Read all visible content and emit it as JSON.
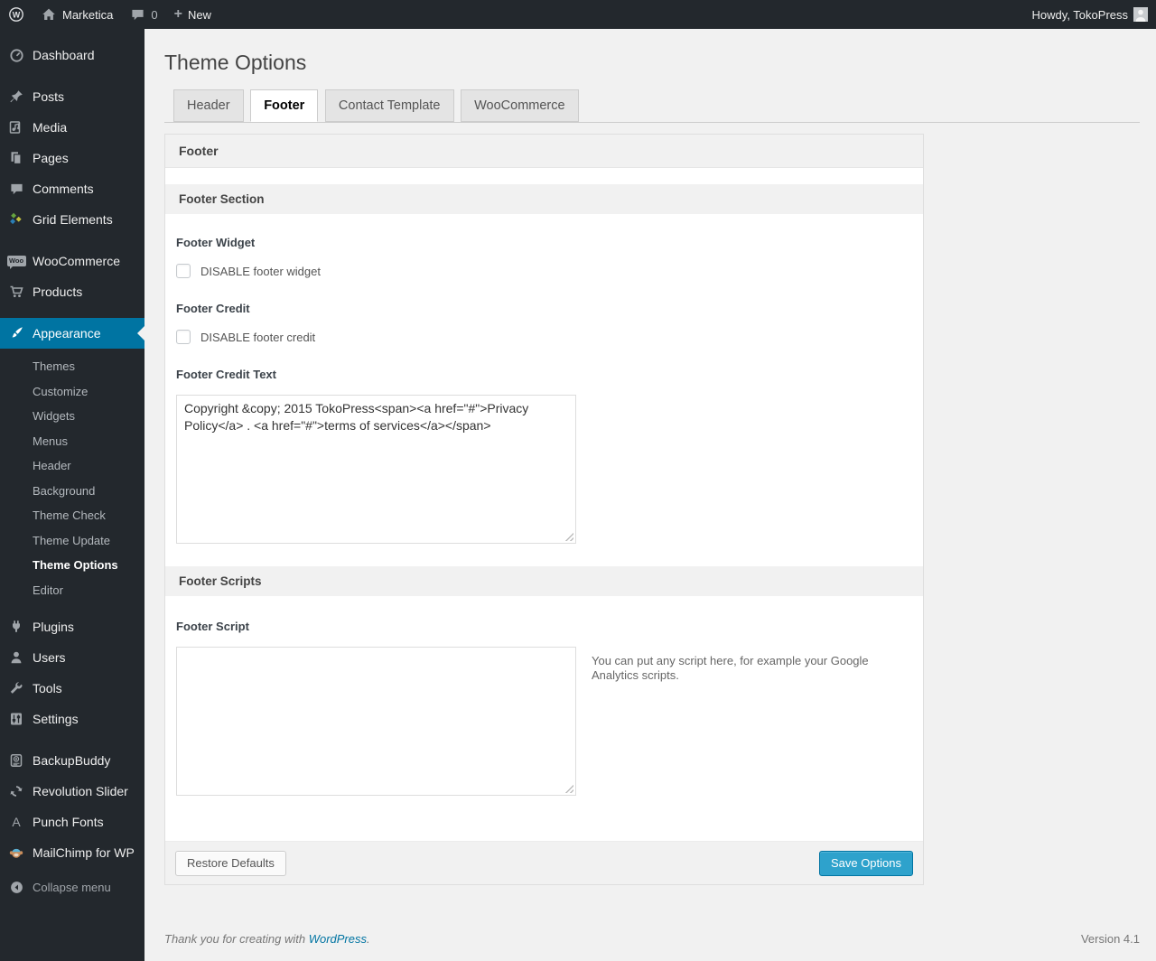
{
  "colors": {
    "admin_dark": "#23282d",
    "accent_blue": "#0074a2",
    "button_blue": "#2ea2cc",
    "page_bg": "#f1f1f1",
    "icon_gray": "#a0a5aa"
  },
  "admin_bar": {
    "site_name": "Marketica",
    "comment_count": "0",
    "new_label": "New",
    "howdy": "Howdy, TokoPress"
  },
  "sidebar": {
    "items": [
      {
        "label": "Dashboard",
        "icon": "dashboard-icon"
      },
      {
        "label": "Posts",
        "icon": "pushpin-icon"
      },
      {
        "label": "Media",
        "icon": "media-icon"
      },
      {
        "label": "Pages",
        "icon": "pages-icon"
      },
      {
        "label": "Comments",
        "icon": "comment-icon"
      },
      {
        "label": "Grid Elements",
        "icon": "grid-elements-icon"
      },
      {
        "label": "WooCommerce",
        "icon": "woocommerce-icon"
      },
      {
        "label": "Products",
        "icon": "cart-icon"
      },
      {
        "label": "Appearance",
        "icon": "brush-icon",
        "active": true
      },
      {
        "label": "Plugins",
        "icon": "plug-icon"
      },
      {
        "label": "Users",
        "icon": "user-icon"
      },
      {
        "label": "Tools",
        "icon": "wrench-icon"
      },
      {
        "label": "Settings",
        "icon": "sliders-icon"
      },
      {
        "label": "BackupBuddy",
        "icon": "backup-icon"
      },
      {
        "label": "Revolution Slider",
        "icon": "rotate-arrows-icon"
      },
      {
        "label": "Punch Fonts",
        "icon": "letter-a-icon"
      },
      {
        "label": "MailChimp for WP",
        "icon": "monkey-icon"
      }
    ],
    "appearance_submenu": {
      "items": [
        "Themes",
        "Customize",
        "Widgets",
        "Menus",
        "Header",
        "Background",
        "Theme Check",
        "Theme Update",
        "Theme Options",
        "Editor"
      ],
      "current": "Theme Options"
    },
    "collapse_label": "Collapse menu"
  },
  "main": {
    "title": "Theme Options",
    "tabs": [
      {
        "label": "Header",
        "active": false
      },
      {
        "label": "Footer",
        "active": true
      },
      {
        "label": "Contact Template",
        "active": false
      },
      {
        "label": "WooCommerce",
        "active": false
      }
    ],
    "panel_title": "Footer",
    "footer_section": {
      "title": "Footer Section",
      "footer_widget": {
        "label": "Footer Widget",
        "checkbox_label": "DISABLE footer widget",
        "checked": false
      },
      "footer_credit": {
        "label": "Footer Credit",
        "checkbox_label": "DISABLE footer credit",
        "checked": false
      },
      "footer_credit_text": {
        "label": "Footer Credit Text",
        "value": "Copyright &copy; 2015 TokoPress<span><a href=\"#\">Privacy Policy</a> . <a href=\"#\">terms of services</a></span>"
      }
    },
    "footer_scripts": {
      "title": "Footer Scripts",
      "footer_script": {
        "label": "Footer Script",
        "value": "",
        "hint": "You can put any script here, for example your Google Analytics scripts."
      }
    },
    "actions": {
      "restore": "Restore Defaults",
      "save": "Save Options"
    }
  },
  "page_footer": {
    "thanks_prefix": "Thank you for creating with ",
    "wordpress_link": "WordPress",
    "suffix": ".",
    "version": "Version 4.1"
  }
}
